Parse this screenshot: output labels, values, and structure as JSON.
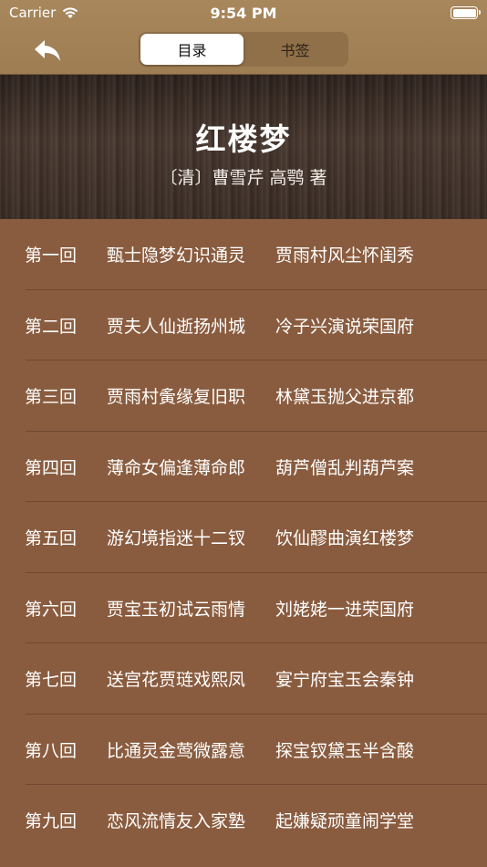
{
  "status": {
    "carrier": "Carrier",
    "time": "9:54 PM"
  },
  "tabs": [
    {
      "label": "目录",
      "active": true
    },
    {
      "label": "书签",
      "active": false
    }
  ],
  "book": {
    "title": "红楼梦",
    "author": "〔清〕曹雪芹 高鹗 著"
  },
  "chapters": [
    {
      "num": "第一回",
      "a": "甄士隐梦幻识通灵",
      "b": "贾雨村风尘怀闺秀"
    },
    {
      "num": "第二回",
      "a": "贾夫人仙逝扬州城",
      "b": "冷子兴演说荣国府"
    },
    {
      "num": "第三回",
      "a": "贾雨村夤缘复旧职",
      "b": "林黛玉抛父进京都"
    },
    {
      "num": "第四回",
      "a": "薄命女偏逢薄命郎",
      "b": "葫芦僧乱判葫芦案"
    },
    {
      "num": "第五回",
      "a": "游幻境指迷十二钗",
      "b": "饮仙醪曲演红楼梦"
    },
    {
      "num": "第六回",
      "a": "贾宝玉初试云雨情",
      "b": "刘姥姥一进荣国府"
    },
    {
      "num": "第七回",
      "a": "送宫花贾琏戏熙凤",
      "b": "宴宁府宝玉会秦钟"
    },
    {
      "num": "第八回",
      "a": "比通灵金莺微露意",
      "b": "探宝钗黛玉半含酸"
    },
    {
      "num": "第九回",
      "a": "恋风流情友入家塾",
      "b": "起嫌疑顽童闹学堂"
    }
  ]
}
